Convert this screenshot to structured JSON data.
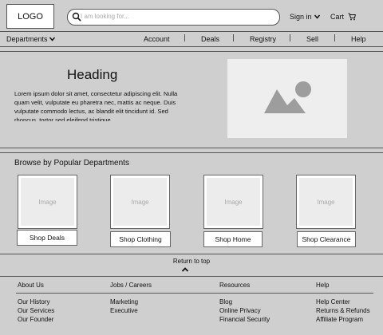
{
  "header": {
    "logo": "LOGO",
    "search_placeholder": "I am looking for...",
    "signin": "Sign in",
    "cart": "Cart"
  },
  "nav": {
    "departments": "Departments",
    "items": [
      "Account",
      "Deals",
      "Registry",
      "Sell",
      "Help"
    ]
  },
  "hero": {
    "heading": "Heading",
    "body": "Lorem ipsum dolor sit amet, consectetur adipiscing elit. Nulla quam velit, vulputate eu pharetra nec, mattis ac neque. Duis vulputate commodo lectus, ac blandit elit tincidunt id. Sed rhoncus, tortor sed eleifend tristique"
  },
  "browse": {
    "title": "Browse by Popular Departments",
    "image_label": "Image",
    "cards": [
      {
        "label": "Shop Deals"
      },
      {
        "label": "Shop Clothing"
      },
      {
        "label": "Shop Home"
      },
      {
        "label": "Shop Clearance"
      }
    ]
  },
  "return_to_top": "Return to top",
  "footer": {
    "columns": [
      {
        "heading": "About Us",
        "links": [
          "Our History",
          "Our Services",
          "Our Founder"
        ]
      },
      {
        "heading": "Jobs / Careers",
        "links": [
          "Marketing",
          "Executive"
        ]
      },
      {
        "heading": "Resources",
        "links": [
          "Blog",
          "Online Privacy",
          "Financial Security"
        ]
      },
      {
        "heading": "Help",
        "links": [
          "Help Center",
          "Returns & Refunds",
          "Affiliate Program"
        ]
      }
    ]
  },
  "colors": {
    "background": "#cfcfcf",
    "placeholder": "#eeeeee",
    "border": "#555555"
  },
  "icons": [
    "search-icon",
    "chevron-down-icon",
    "cart-icon",
    "image-placeholder-icon",
    "chevron-up-icon"
  ]
}
